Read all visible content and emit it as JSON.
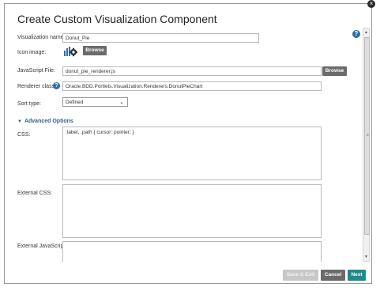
{
  "dialog": {
    "title": "Create Custom Visualization Component",
    "close_glyph": "×",
    "help_glyph": "?"
  },
  "form": {
    "visualization_name_label": "Visualization name:",
    "visualization_name_value": "Donut_Pie",
    "icon_image_label": "Icon image:",
    "icon_browse_label": "Browse",
    "javascript_file_label": "JavaScript File:",
    "javascript_file_value": "donut_pie_renderer.js",
    "javascript_browse_label": "Browse",
    "renderer_class_label": "Renderer class:",
    "renderer_class_value": "Oracle.BDD.Portlets.Visualization.Renderers.DonutPieChart",
    "sort_type_label": "Sort type:",
    "sort_type_value": "Defined",
    "advanced_options_label": "Advanced Options",
    "css_label": "CSS:",
    "css_value": ".label, .path { cursor: pointer; }",
    "external_css_label": "External CSS:",
    "external_css_value": "",
    "external_js_label": "External JavaScript:",
    "external_js_value": ""
  },
  "footer": {
    "save_exit_label": "Save & Exit",
    "cancel_label": "Cancel",
    "next_label": "Next"
  },
  "colors": {
    "accent": "#1f8a8a",
    "help": "#2f6ea6",
    "button_dark": "#6b6b6b",
    "button_disabled": "#c8c8c8"
  },
  "icons": {
    "close": "close-icon",
    "help": "help-icon",
    "chart_gear": "chart-gear-icon",
    "triangle": "triangle-down-icon",
    "chevron": "chevron-down-icon"
  }
}
